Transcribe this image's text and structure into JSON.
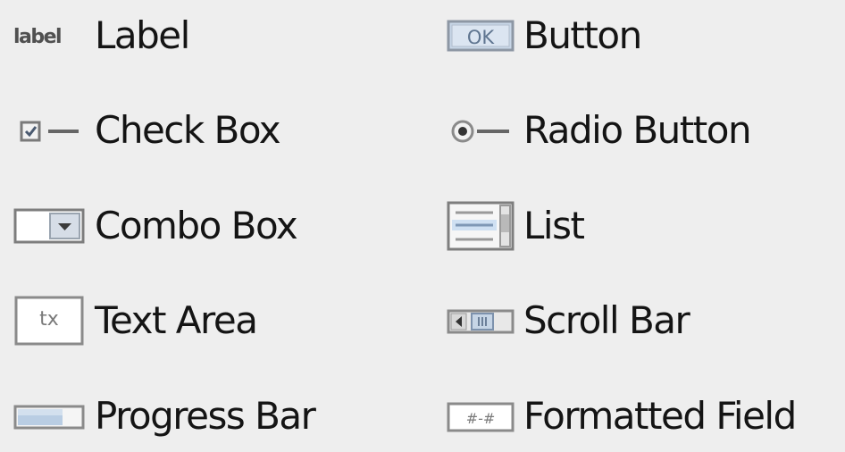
{
  "palette": {
    "items": [
      {
        "label": "Label",
        "icon": "label-icon",
        "icon_text": "label"
      },
      {
        "label": "Button",
        "icon": "button-icon",
        "icon_text": "OK"
      },
      {
        "label": "Check Box",
        "icon": "checkbox-icon"
      },
      {
        "label": "Radio Button",
        "icon": "radio-button-icon"
      },
      {
        "label": "Combo Box",
        "icon": "combo-box-icon"
      },
      {
        "label": "List",
        "icon": "list-icon"
      },
      {
        "label": "Text Area",
        "icon": "text-area-icon",
        "icon_text": "tx"
      },
      {
        "label": "Scroll Bar",
        "icon": "scroll-bar-icon"
      },
      {
        "label": "Progress Bar",
        "icon": "progress-bar-icon"
      },
      {
        "label": "Formatted Field",
        "icon": "formatted-field-icon",
        "icon_text": "#-#"
      }
    ]
  }
}
